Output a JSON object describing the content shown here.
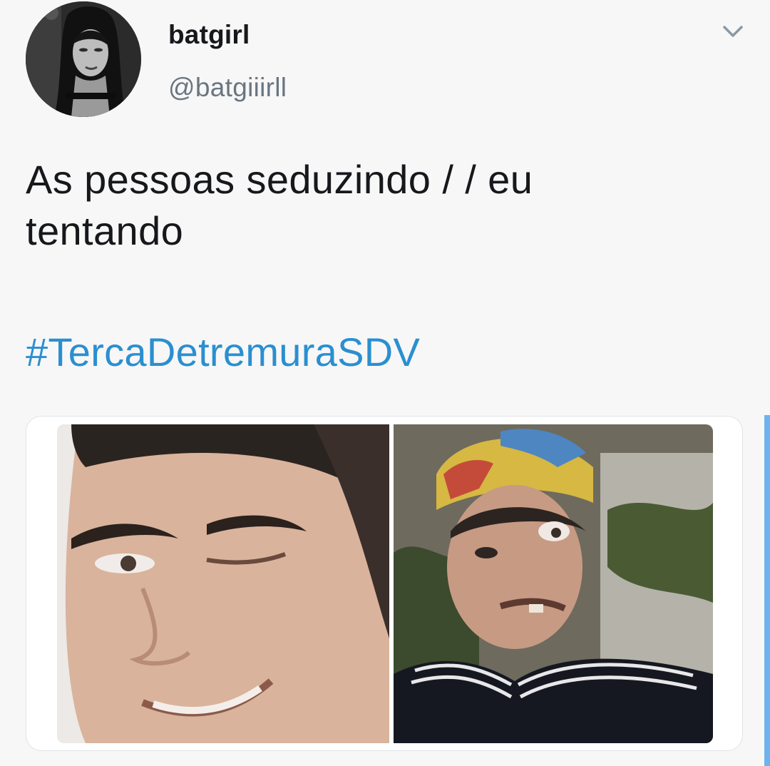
{
  "tweet": {
    "author": {
      "display_name": "batgirl",
      "handle": "@batgiiirll",
      "avatar_icon": "profile-photo"
    },
    "menu_icon": "chevron-down-icon",
    "text_lines": [
      "As pessoas seduzindo / / eu",
      "tentando"
    ],
    "hashtag": "#TercaDetremuraSDV",
    "media": {
      "layout": "two-image-grid",
      "images": [
        "meme-photo-winking-man",
        "meme-photo-chaves-character"
      ]
    }
  },
  "colors": {
    "background": "#f7f7f8",
    "text": "#16181b",
    "secondary_text": "#6a7580",
    "link": "#2a8fd0",
    "accent": "#6fb3ee"
  }
}
